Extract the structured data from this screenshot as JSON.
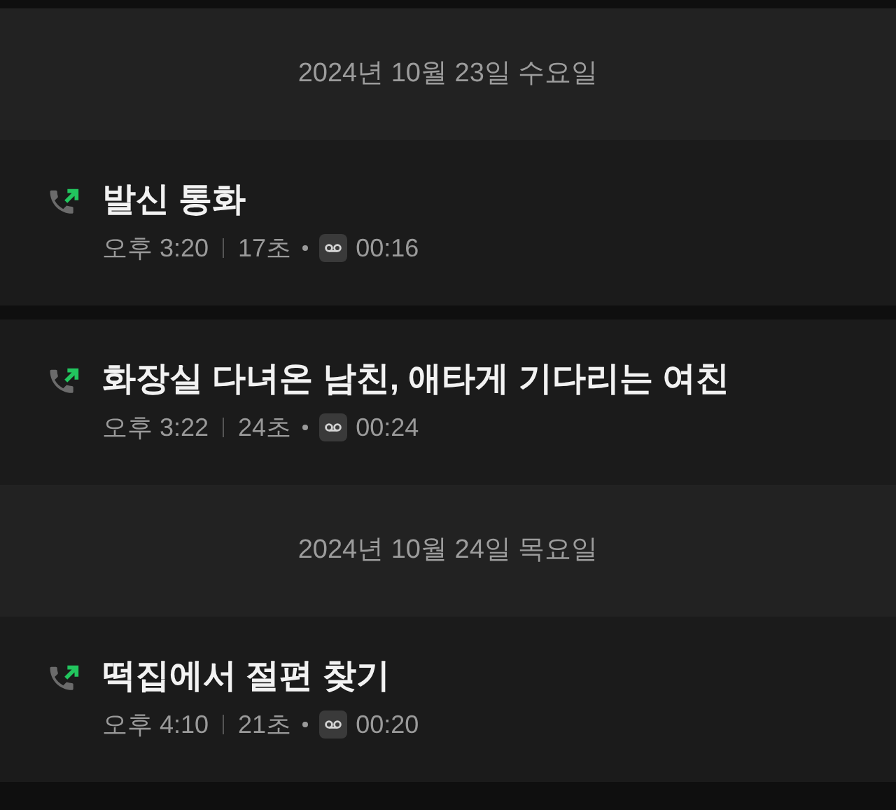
{
  "sections": [
    {
      "date": "2024년 10월 23일 수요일",
      "calls": [
        {
          "kind": "outgoing",
          "title": "발신 통화",
          "time": "오후 3:20",
          "duration": "17초",
          "recording": "00:16"
        },
        {
          "kind": "outgoing",
          "title": "화장실 다녀온 남친, 애타게 기다리는 여친",
          "time": "오후 3:22",
          "duration": "24초",
          "recording": "00:24"
        }
      ]
    },
    {
      "date": "2024년 10월 24일 목요일",
      "calls": [
        {
          "kind": "outgoing",
          "title": "떡집에서 절편 찾기",
          "time": "오후 4:10",
          "duration": "21초",
          "recording": "00:20"
        }
      ]
    }
  ]
}
